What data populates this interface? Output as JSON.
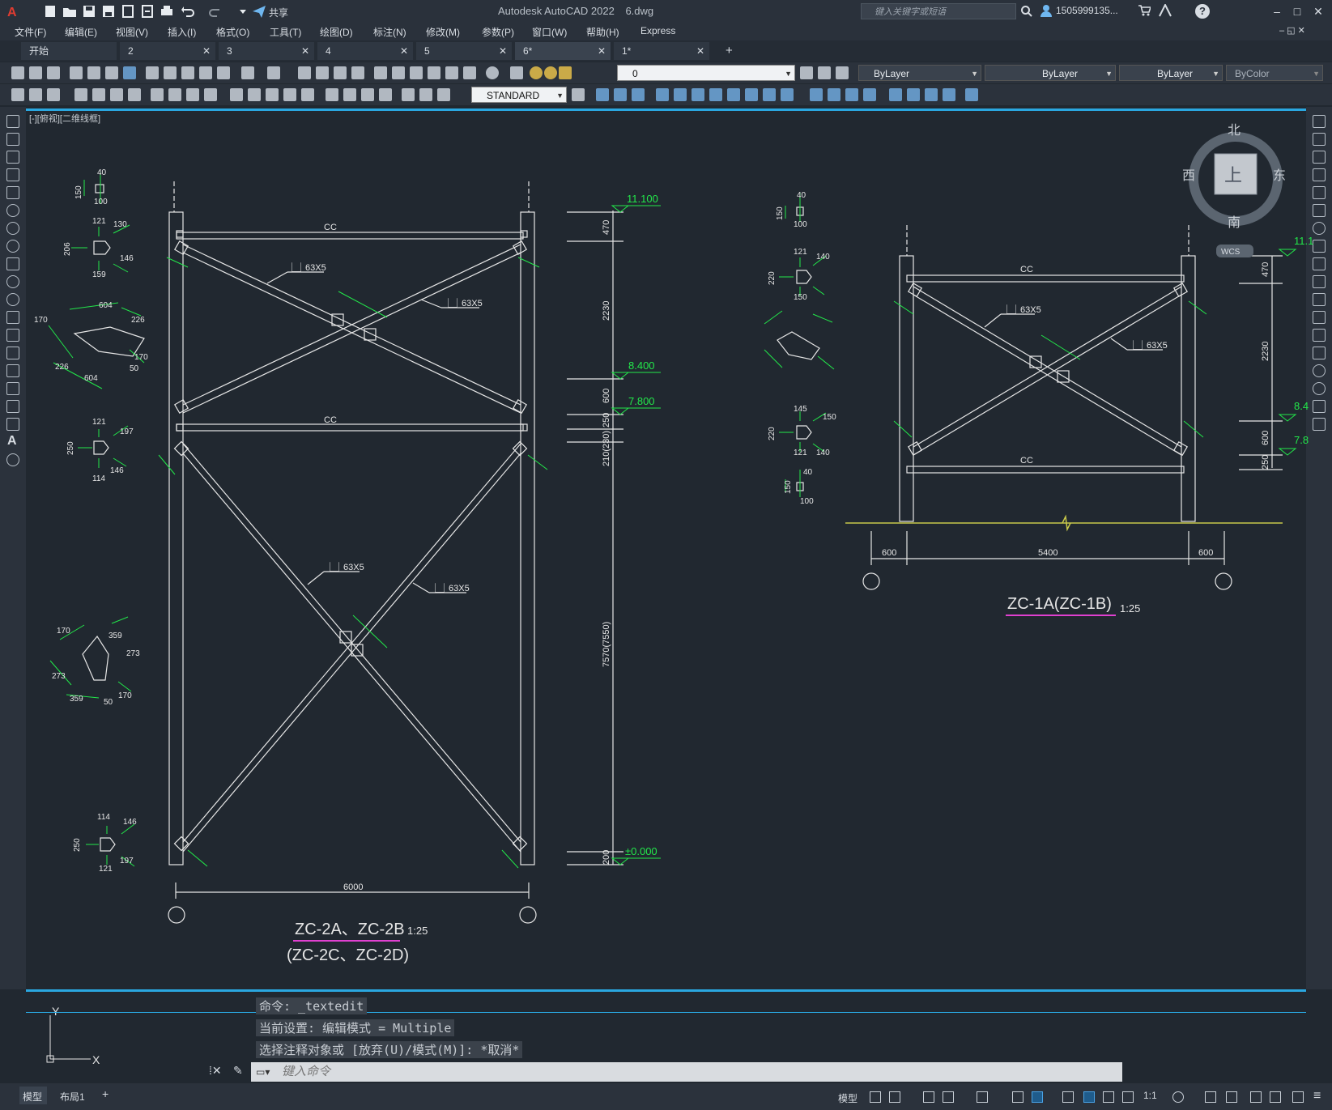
{
  "title_bar": {
    "app_title": "Autodesk AutoCAD 2022",
    "file_name": "6.dwg",
    "share_label": "共享",
    "search_placeholder": "键入关键字或短语",
    "user_name": "1505999135...",
    "help_icon": "help-icon"
  },
  "menu": [
    "文件(F)",
    "编辑(E)",
    "视图(V)",
    "插入(I)",
    "格式(O)",
    "工具(T)",
    "绘图(D)",
    "标注(N)",
    "修改(M)",
    "参数(P)",
    "窗口(W)",
    "帮助(H)",
    "Express"
  ],
  "tabs": [
    {
      "label": "开始",
      "closable": false
    },
    {
      "label": "2",
      "closable": true
    },
    {
      "label": "3",
      "closable": true
    },
    {
      "label": "4",
      "closable": true
    },
    {
      "label": "5",
      "closable": true
    },
    {
      "label": "6*",
      "closable": true,
      "active": true
    },
    {
      "label": "1*",
      "closable": true
    }
  ],
  "properties": {
    "layer": "0",
    "color": "ByLayer",
    "linetype": "ByLayer",
    "lineweight": "ByLayer",
    "plotstyle": "ByColor",
    "dimstyle": "STANDARD"
  },
  "view_label": "[-][俯视][二维线框]",
  "viewcube": {
    "north": "北",
    "south": "南",
    "east": "东",
    "west": "西",
    "face": "上",
    "wcs": "WCS"
  },
  "drawing": {
    "left_frame": {
      "beam_label": "CC",
      "brace_labels": [
        "⎿⏌63X5",
        "⎿⏌63X5",
        "⎿⏌63X5",
        "⎿⏌63X5"
      ],
      "elevations": [
        "11.100",
        "8.400",
        "7.800",
        "±0.000"
      ],
      "vertical_dims": [
        "470",
        "2230",
        "600",
        "250",
        "210(230)",
        "7570(7550)",
        "200"
      ],
      "span_dim": "6000",
      "title": "ZC-2A、ZC-2B",
      "subtitle": "(ZC-2C、ZC-2D)",
      "scale": "1:25"
    },
    "right_frame": {
      "beam_label": "CC",
      "brace_labels": [
        "⎿⏌63X5",
        "⎿⏌63X5"
      ],
      "elevations": [
        "11.1",
        "8.4",
        "7.8"
      ],
      "vertical_dims": [
        "470",
        "2230",
        "600",
        "250"
      ],
      "span_dims": [
        "600",
        "5400",
        "600"
      ],
      "title": "ZC-1A(ZC-1B)",
      "scale": "1:25"
    },
    "plate_dims_left": [
      "40",
      "150",
      "100",
      "121",
      "130",
      "206",
      "146",
      "159",
      "604",
      "226",
      "170",
      "604",
      "226",
      "50",
      "170",
      "121",
      "197",
      "250",
      "146",
      "114",
      "170",
      "359",
      "273",
      "273",
      "359",
      "50",
      "170",
      "114",
      "146",
      "250",
      "197",
      "121"
    ],
    "plate_dims_right": [
      "40",
      "150",
      "100",
      "121",
      "140",
      "220",
      "150",
      "145",
      "150",
      "220",
      "121",
      "140",
      "40",
      "150",
      "100"
    ]
  },
  "command": {
    "history": [
      "命令: _textedit",
      "当前设置: 编辑模式 = Multiple",
      "选择注释对象或 [放弃(U)/模式(M)]: *取消*"
    ],
    "placeholder": "键入命令"
  },
  "status": {
    "layout_tabs": [
      "模型",
      "布局1"
    ],
    "model_label": "模型",
    "scale": "1:1"
  },
  "colors": {
    "canvas": "#212830",
    "accent": "#2aa7e0",
    "dimension": "#22e84a",
    "geometry": "#e6e6e6",
    "ground": "#c8c84a",
    "title_underline": "#e040d0"
  }
}
